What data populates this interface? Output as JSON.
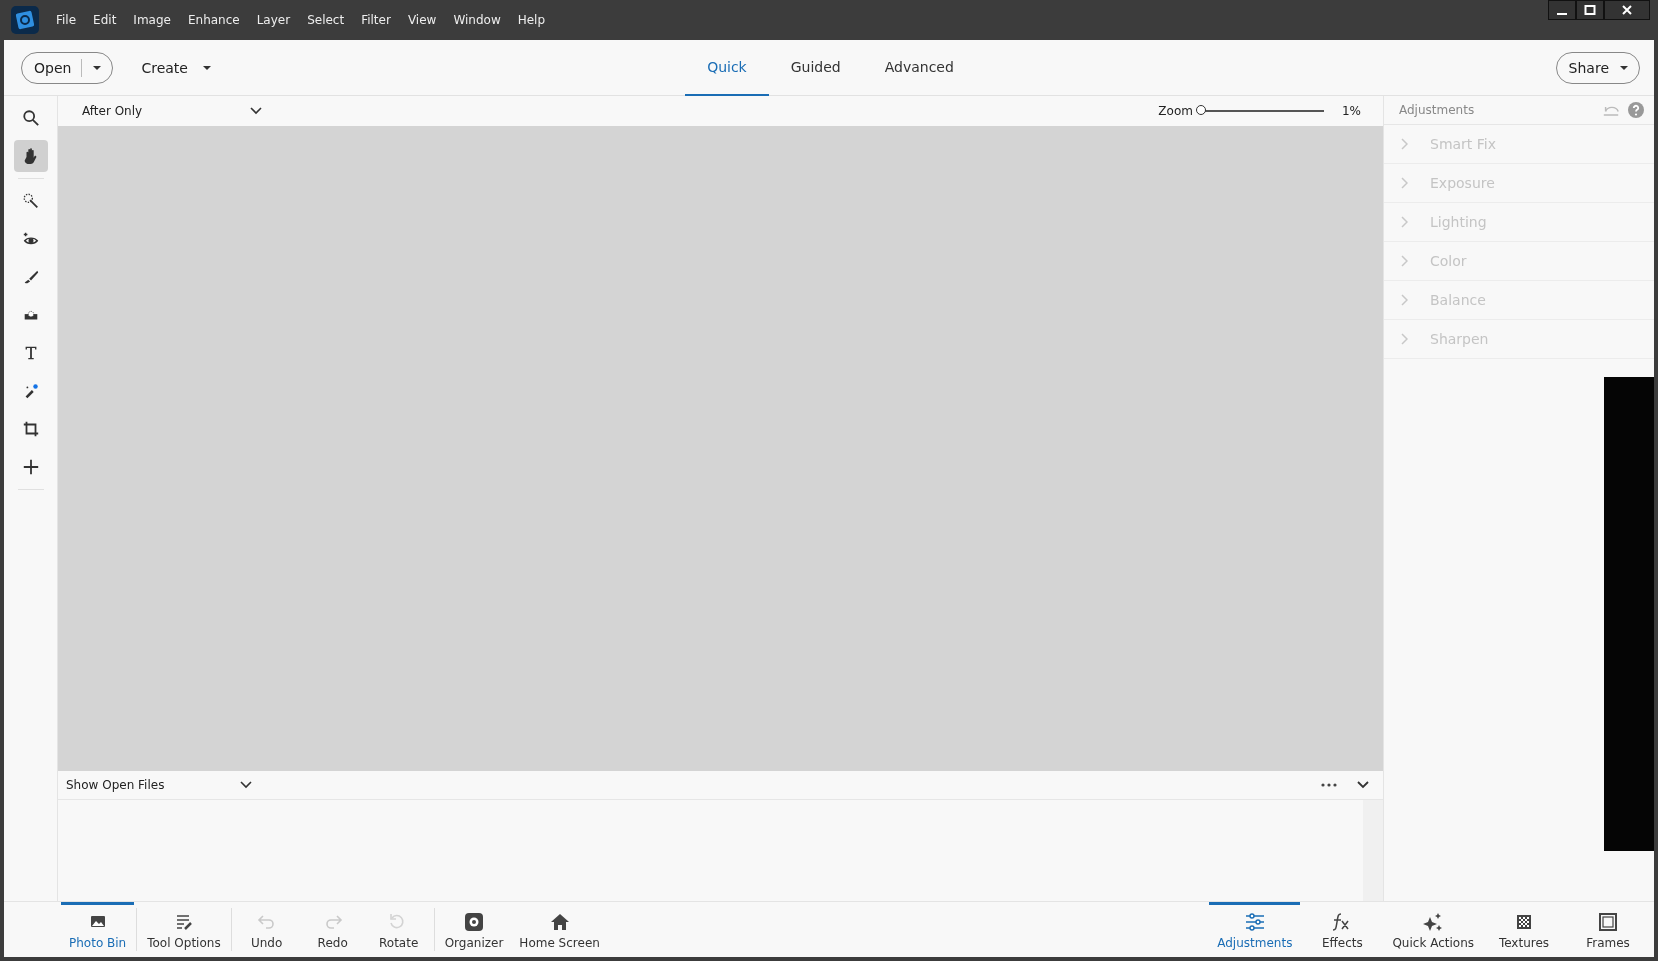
{
  "menu": [
    "File",
    "Edit",
    "Image",
    "Enhance",
    "Layer",
    "Select",
    "Filter",
    "View",
    "Window",
    "Help"
  ],
  "toolbar": {
    "open": "Open",
    "create": "Create",
    "share": "Share"
  },
  "modes": [
    {
      "label": "Quick",
      "selected": true
    },
    {
      "label": "Guided",
      "selected": false
    },
    {
      "label": "Advanced",
      "selected": false
    }
  ],
  "view_select": "After Only",
  "zoom": {
    "label": "Zoom",
    "level": 0.0,
    "reading": "1%"
  },
  "tools": [
    {
      "kind": "zoom",
      "selected": false
    },
    {
      "kind": "hand",
      "selected": true
    },
    {
      "kind": "quick-select",
      "selected": false
    },
    {
      "kind": "eye",
      "selected": false
    },
    {
      "kind": "brush",
      "selected": false
    },
    {
      "kind": "whiten",
      "selected": false
    },
    {
      "kind": "text",
      "selected": false
    },
    {
      "kind": "spot",
      "selected": false
    },
    {
      "kind": "crop",
      "selected": false
    },
    {
      "kind": "move",
      "selected": false
    }
  ],
  "panel": {
    "title": "Adjustments",
    "items": [
      {
        "label": "Smart Fix",
        "disabled": true
      },
      {
        "label": "Exposure",
        "disabled": true
      },
      {
        "label": "Lighting",
        "disabled": true
      },
      {
        "label": "Color",
        "disabled": true
      },
      {
        "label": "Balance",
        "disabled": true
      },
      {
        "label": "Sharpen",
        "disabled": true
      }
    ]
  },
  "bin": {
    "select": "Show Open Files"
  },
  "bottom_left": [
    {
      "kind": "photo-bin",
      "label": "Photo Bin",
      "selected": true,
      "disabled": false
    },
    {
      "kind": "tool-options",
      "label": "Tool Options",
      "selected": false,
      "disabled": false
    },
    {
      "kind": "undo",
      "label": "Undo",
      "selected": false,
      "disabled": true
    },
    {
      "kind": "redo",
      "label": "Redo",
      "selected": false,
      "disabled": true
    },
    {
      "kind": "rotate",
      "label": "Rotate",
      "selected": false,
      "disabled": true
    },
    {
      "kind": "organizer",
      "label": "Organizer",
      "selected": false,
      "disabled": false
    },
    {
      "kind": "home",
      "label": "Home Screen",
      "selected": false,
      "disabled": false
    }
  ],
  "bottom_right": [
    {
      "kind": "adjustments",
      "label": "Adjustments",
      "selected": true
    },
    {
      "kind": "effects",
      "label": "Effects",
      "selected": false
    },
    {
      "kind": "quick-actions",
      "label": "Quick Actions",
      "selected": false
    },
    {
      "kind": "textures",
      "label": "Textures",
      "selected": false
    },
    {
      "kind": "frames",
      "label": "Frames",
      "selected": false
    }
  ]
}
